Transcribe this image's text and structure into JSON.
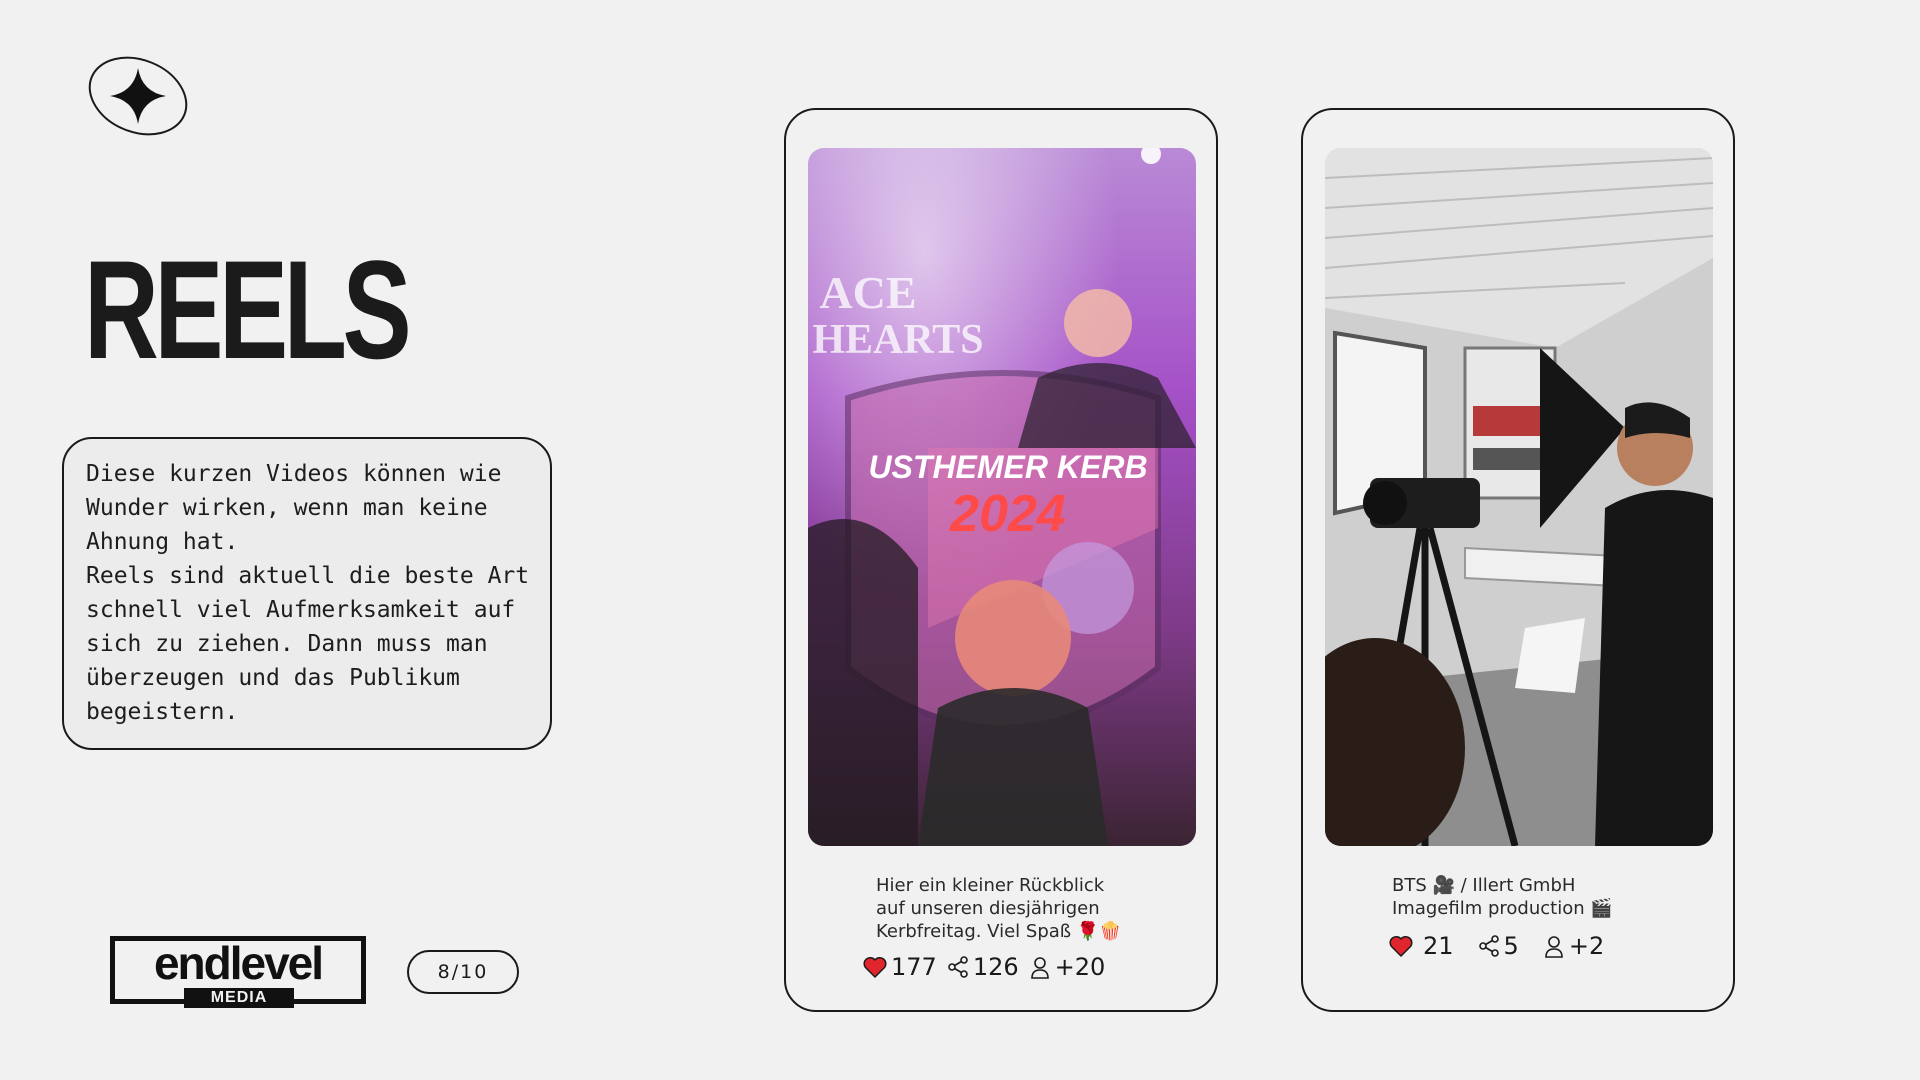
{
  "slide": {
    "title": "REELS",
    "description_lines": [
      "Diese kurzen Videos können wie",
      "Wunder wirken, wenn man keine",
      "Ahnung hat.",
      "Reels sind aktuell die beste Art",
      "schnell viel Aufmerksamkeit auf",
      "sich zu ziehen. Dann muss man",
      "überzeugen und das Publikum",
      "begeistern."
    ],
    "page_indicator": "8/10"
  },
  "brand": {
    "word": "endlevel",
    "sub": "MEDIA"
  },
  "reels": [
    {
      "caption_lines": [
        "Hier ein kleiner Rückblick",
        "auf unseren diesjährigen",
        "Kerbfreitag. Viel Spaß 🌹🍿"
      ],
      "likes": "177",
      "shares": "126",
      "collaborators": "+20",
      "overlay_text_1": "USTHEMER KERB",
      "overlay_text_2": "2024",
      "overlay_text_3": "ACE",
      "overlay_text_4": "HEARTS"
    },
    {
      "caption_lines": [
        "BTS 🎥 / Illert GmbH",
        "Imagefilm production 🎬"
      ],
      "likes": "21",
      "shares": "5",
      "collaborators": "+2"
    }
  ],
  "icons": {
    "logo": "four-point-star-icon",
    "like": "heart-icon",
    "share": "share-icon",
    "collab": "person-icon"
  },
  "colors": {
    "background": "#f1f1f1",
    "text": "#1a1a1a",
    "heart": "#e0262c"
  }
}
